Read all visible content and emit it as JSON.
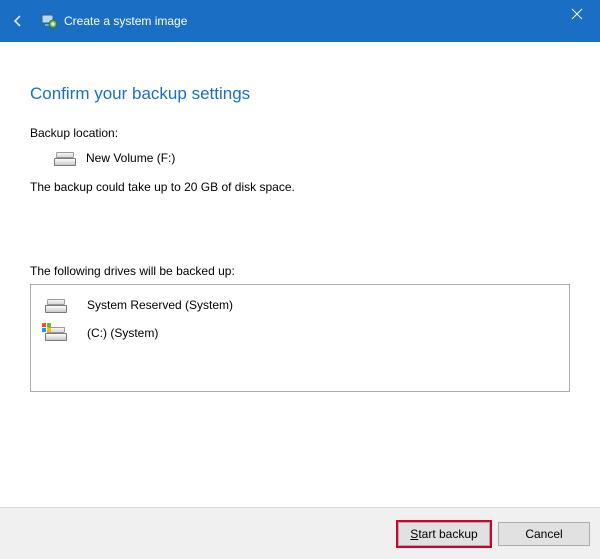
{
  "titlebar": {
    "title": "Create a system image"
  },
  "heading": "Confirm your backup settings",
  "location": {
    "label": "Backup location:",
    "drive_name": "New Volume (F:)"
  },
  "size_hint": "The backup could take up to 20 GB of disk space.",
  "drives": {
    "label": "The following drives will be backed up:",
    "items": [
      {
        "name": "System Reserved (System)",
        "os_badge": false
      },
      {
        "name": "(C:) (System)",
        "os_badge": true
      }
    ]
  },
  "footer": {
    "start_label": "Start backup",
    "cancel_label": "Cancel"
  }
}
